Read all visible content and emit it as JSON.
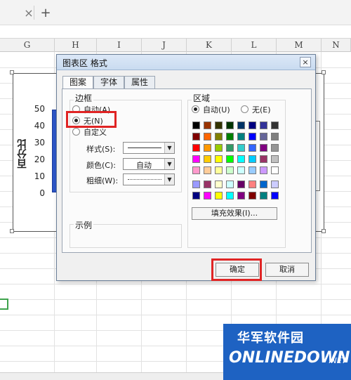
{
  "sheet": {
    "tab_close": "×",
    "tab_add": "+",
    "columns": [
      "G",
      "H",
      "I",
      "J",
      "K",
      "L",
      "M",
      "N"
    ]
  },
  "chart": {
    "y_axis_title": "百分比",
    "y_ticks": [
      "50",
      "40",
      "30",
      "20",
      "10",
      "0"
    ]
  },
  "dialog": {
    "title": "图表区 格式",
    "close": "×",
    "tabs": [
      "图案",
      "字体",
      "属性"
    ],
    "border": {
      "label": "边框",
      "options": [
        "自动(A)",
        "无(N)",
        "自定义"
      ],
      "selected": "无(N)",
      "style_label": "样式(S):",
      "color_label": "颜色(C):",
      "color_value": "自动",
      "weight_label": "粗细(W):"
    },
    "area": {
      "label": "区域",
      "options": [
        "自动(U)",
        "无(E)"
      ],
      "selected": "自动(U)",
      "fill_button": "填充效果(I)..."
    },
    "sample_label": "示例",
    "ok": "确定",
    "cancel": "取消",
    "palette": [
      [
        "#000000",
        "#993300",
        "#333300",
        "#003300",
        "#003366",
        "#000080",
        "#333399",
        "#333333"
      ],
      [
        "#800000",
        "#ff6600",
        "#808000",
        "#008000",
        "#008080",
        "#0000ff",
        "#666699",
        "#808080"
      ],
      [
        "#ff0000",
        "#ff9900",
        "#99cc00",
        "#339966",
        "#33cccc",
        "#3366ff",
        "#800080",
        "#969696"
      ],
      [
        "#ff00ff",
        "#ffcc00",
        "#ffff00",
        "#00ff00",
        "#00ffff",
        "#00ccff",
        "#993366",
        "#c0c0c0"
      ],
      [
        "#ff99cc",
        "#ffcc99",
        "#ffff99",
        "#ccffcc",
        "#ccffff",
        "#99ccff",
        "#cc99ff",
        "#ffffff"
      ],
      [
        "#9999ff",
        "#993366",
        "#ffffcc",
        "#ccffff",
        "#660066",
        "#ff8080",
        "#0066cc",
        "#ccccff"
      ],
      [
        "#000080",
        "#ff00ff",
        "#ffff00",
        "#00ffff",
        "#800080",
        "#800000",
        "#008080",
        "#0000ff"
      ]
    ]
  },
  "watermark": {
    "cn": "华军软件园",
    "en": "ONLINEDOWN",
    "net": ".NET"
  },
  "colors": {
    "highlight": "#e02424",
    "bar": "#2c55c8",
    "watermark_bg": "#1e62c2"
  }
}
